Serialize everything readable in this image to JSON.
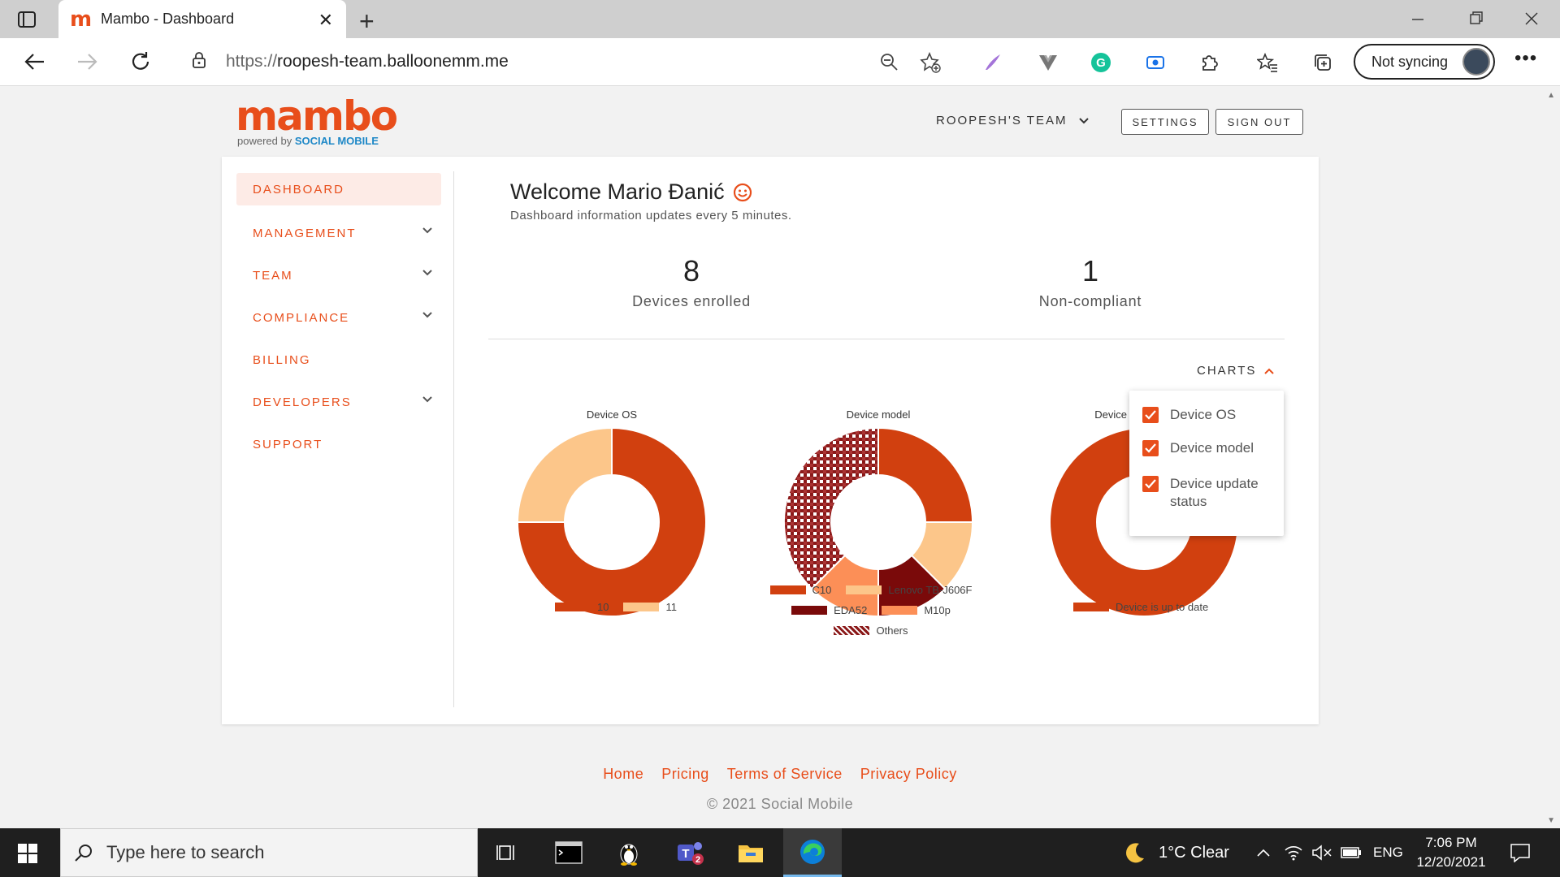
{
  "browser": {
    "tab_title": "Mambo - Dashboard",
    "favicon": "m",
    "url_protocol": "https://",
    "url_host": "roopesh-team.balloonemm.me",
    "sync_label": "Not syncing"
  },
  "header": {
    "logo_word": "mambo",
    "logo_sub_prefix": "powered by ",
    "logo_sub_brand": "SOCIAL MOBILE",
    "team": "ROOPESH'S TEAM",
    "settings": "SETTINGS",
    "signout": "SIGN OUT"
  },
  "sidebar": {
    "items": [
      {
        "label": "DASHBOARD",
        "active": true,
        "expandable": false
      },
      {
        "label": "MANAGEMENT",
        "active": false,
        "expandable": true
      },
      {
        "label": "TEAM",
        "active": false,
        "expandable": true
      },
      {
        "label": "COMPLIANCE",
        "active": false,
        "expandable": true
      },
      {
        "label": "BILLING",
        "active": false,
        "expandable": false
      },
      {
        "label": "DEVELOPERS",
        "active": false,
        "expandable": true
      },
      {
        "label": "SUPPORT",
        "active": false,
        "expandable": false
      }
    ]
  },
  "main": {
    "welcome": "Welcome Mario Đanić",
    "subtitle": "Dashboard information updates every 5 minutes.",
    "stats": [
      {
        "value": "8",
        "label": "Devices enrolled"
      },
      {
        "value": "1",
        "label": "Non-compliant"
      }
    ],
    "charts_toggle": "CHARTS",
    "dropdown": [
      {
        "label": "Device OS",
        "checked": true
      },
      {
        "label": "Device model",
        "checked": true
      },
      {
        "label": "Device update status",
        "checked": true
      }
    ]
  },
  "chart_data": [
    {
      "type": "pie",
      "title": "Device OS",
      "categories": [
        "10",
        "11"
      ],
      "values": [
        6,
        2
      ],
      "colors": [
        "#d1400f",
        "#fcc68a"
      ]
    },
    {
      "type": "pie",
      "title": "Device model",
      "categories": [
        "C10",
        "Lenovo TB-J606F",
        "EDA52",
        "M10p",
        "Others"
      ],
      "values": [
        2,
        1,
        1,
        1,
        3
      ],
      "colors": [
        "#d1400f",
        "#fcc68a",
        "#7a0a0a",
        "#fc8f57",
        "#8b1a1a"
      ],
      "patterned": [
        "Others"
      ]
    },
    {
      "type": "pie",
      "title": "Device update status",
      "categories": [
        "Device is up to date"
      ],
      "values": [
        8
      ],
      "colors": [
        "#d1400f"
      ]
    }
  ],
  "footer": {
    "links": [
      "Home",
      "Pricing",
      "Terms of Service",
      "Privacy Policy"
    ],
    "copyright": "© 2021 Social Mobile"
  },
  "taskbar": {
    "search_placeholder": "Type here to search",
    "weather": "1°C  Clear",
    "language": "ENG",
    "time": "7:06 PM",
    "date": "12/20/2021",
    "teams_badge": "2"
  }
}
